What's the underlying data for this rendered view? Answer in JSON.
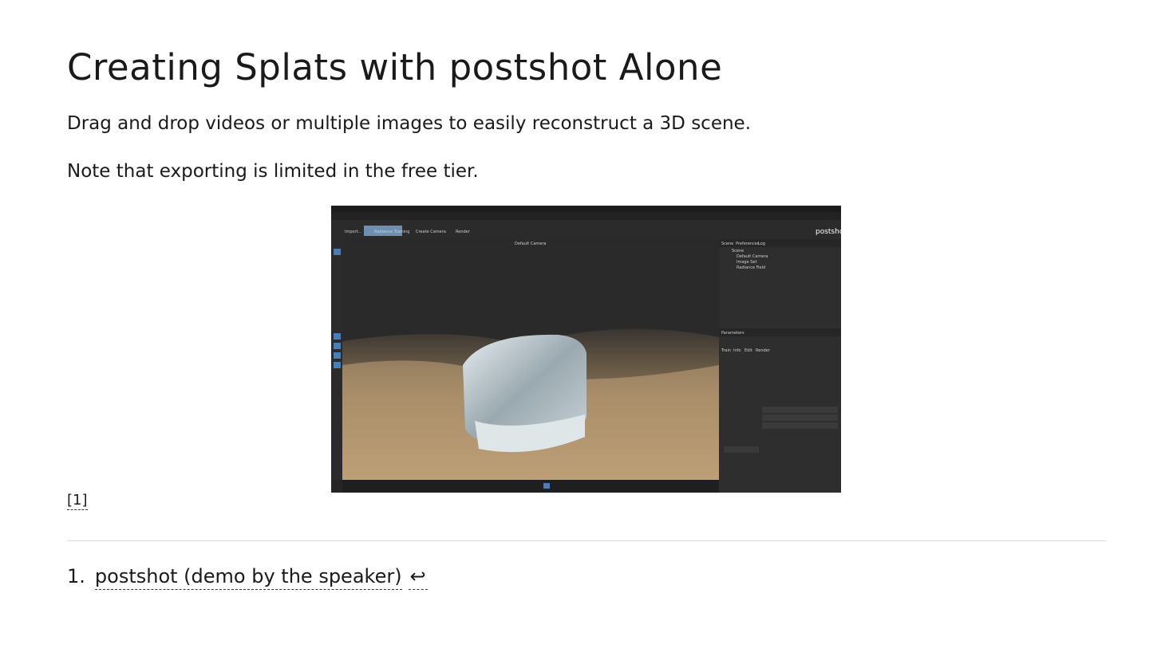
{
  "slide": {
    "title": "Creating Splats with postshot Alone",
    "paragraphs": [
      "Drag and drop videos or multiple images to easily reconstruct a 3D scene.",
      "Note that exporting is limited in the free tier."
    ],
    "reference_marker": "[1]"
  },
  "screenshot": {
    "toolbar": [
      "Import...",
      "Radiance Training",
      "Create Camera",
      "Render"
    ],
    "brand": "postshot",
    "viewport_label": "Default Camera",
    "panel_tabs": [
      "Scene",
      "Preferences",
      "Log"
    ],
    "scene_tree": [
      "Scene",
      "Default Camera",
      "Image Set",
      "Radiance Field"
    ],
    "params_title": "Parameters",
    "params_subtabs": [
      "Train",
      "Info",
      "Edit",
      "Render"
    ],
    "colors": {
      "background": "#252525",
      "panel": "#2e2e2e",
      "accent": "#4a7fb5"
    }
  },
  "footnotes": [
    {
      "number": "1.",
      "text": "postshot (demo by the speaker)",
      "backref": "↩"
    }
  ]
}
